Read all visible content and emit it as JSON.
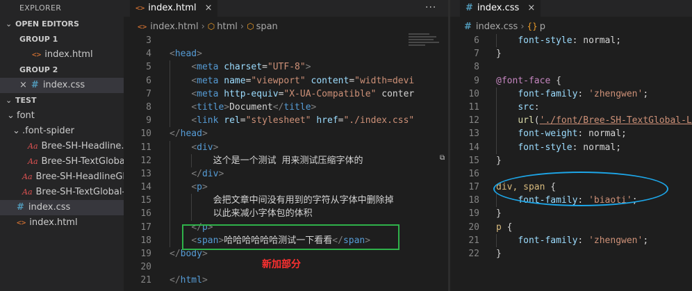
{
  "sidebar": {
    "title": "EXPLORER",
    "open_editors": {
      "label": "OPEN EDITORS",
      "groups": [
        {
          "label": "GROUP 1",
          "files": [
            {
              "name": "index.html",
              "type": "html"
            }
          ]
        },
        {
          "label": "GROUP 2",
          "files": [
            {
              "name": "index.css",
              "type": "css",
              "close": "×"
            }
          ]
        }
      ]
    },
    "project": {
      "label": "TEST",
      "tree": [
        {
          "name": "font",
          "type": "folder"
        },
        {
          "name": ".font-spider",
          "type": "folder"
        },
        {
          "name": "Bree-SH-Headline...",
          "type": "font"
        },
        {
          "name": "Bree-SH-TextGloba...",
          "type": "font"
        },
        {
          "name": "Bree-SH-HeadlineGl...",
          "type": "font"
        },
        {
          "name": "Bree-SH-TextGlobal-...",
          "type": "font"
        },
        {
          "name": "index.css",
          "type": "css"
        },
        {
          "name": "index.html",
          "type": "html"
        }
      ]
    }
  },
  "editor_left": {
    "tab": {
      "label": "index.html",
      "close": "×"
    },
    "more": "···",
    "breadcrumb": [
      "index.html",
      "html",
      "span"
    ],
    "lines": [
      {
        "n": "3",
        "text": ""
      },
      {
        "n": "4",
        "text": "<head>"
      },
      {
        "n": "5",
        "text": "    <meta charset=\"UTF-8\">"
      },
      {
        "n": "6",
        "text": "    <meta name=\"viewport\" content=\"width=devi"
      },
      {
        "n": "7",
        "text": "    <meta http-equiv=\"X-UA-Compatible\" conter"
      },
      {
        "n": "8",
        "text": "    <title>Document</title>"
      },
      {
        "n": "9",
        "text": "    <link rel=\"stylesheet\" href=\"./index.css\""
      },
      {
        "n": "10",
        "text": "</head>"
      },
      {
        "n": "11",
        "text": "    <div>"
      },
      {
        "n": "12",
        "text": "        这个是一个测试 用来测试压缩字体的"
      },
      {
        "n": "13",
        "text": "    </div>"
      },
      {
        "n": "14",
        "text": "    <p>"
      },
      {
        "n": "15",
        "text": "        会把文章中间没有用到的字符从字体中删除掉"
      },
      {
        "n": "16",
        "text": "        以此来减小字体包的体积"
      },
      {
        "n": "17",
        "text": "    </p>"
      },
      {
        "n": "18",
        "text": "    <span>哈哈哈哈哈哈测试一下看看</span>"
      },
      {
        "n": "19",
        "text": "</body>"
      },
      {
        "n": "20",
        "text": ""
      },
      {
        "n": "21",
        "text": "</html>"
      }
    ],
    "annotation": "新加部分",
    "splitter_mark": "⧉"
  },
  "editor_right": {
    "tab": {
      "label": "index.css",
      "close": "×"
    },
    "breadcrumb": [
      "index.css",
      "p"
    ],
    "lines": [
      {
        "n": "6",
        "text": "    font-style: normal;"
      },
      {
        "n": "7",
        "text": "}"
      },
      {
        "n": "8",
        "text": ""
      },
      {
        "n": "9",
        "text": "@font-face {"
      },
      {
        "n": "10",
        "text": "    font-family: 'zhengwen';"
      },
      {
        "n": "11",
        "text": "    src:"
      },
      {
        "n": "12",
        "text": "    url('./font/Bree-SH-TextGlobal-Li"
      },
      {
        "n": "13",
        "text": "    font-weight: normal;"
      },
      {
        "n": "14",
        "text": "    font-style: normal;"
      },
      {
        "n": "15",
        "text": "}"
      },
      {
        "n": "16",
        "text": ""
      },
      {
        "n": "17",
        "text": "div, span {"
      },
      {
        "n": "18",
        "text": "    font-family: 'biaoti';"
      },
      {
        "n": "19",
        "text": "}"
      },
      {
        "n": "20",
        "text": "p {"
      },
      {
        "n": "21",
        "text": "    font-family: 'zhengwen';"
      },
      {
        "n": "22",
        "text": "}"
      }
    ]
  },
  "colors": {
    "annotation_box": "#2fb24a",
    "annotation_text": "#ff3030",
    "highlight_ellipse": "#1da6e8",
    "tag": "#569cd6",
    "attribute": "#9cdcfe",
    "string": "#ce9178",
    "selector": "#d7ba7d",
    "at_rule": "#c586c0"
  },
  "icons": {
    "html": "html-file-icon",
    "css": "css-file-icon",
    "font": "font-file-icon",
    "folder_chevron": "chevron-icon",
    "symbol": "symbol-icon"
  }
}
